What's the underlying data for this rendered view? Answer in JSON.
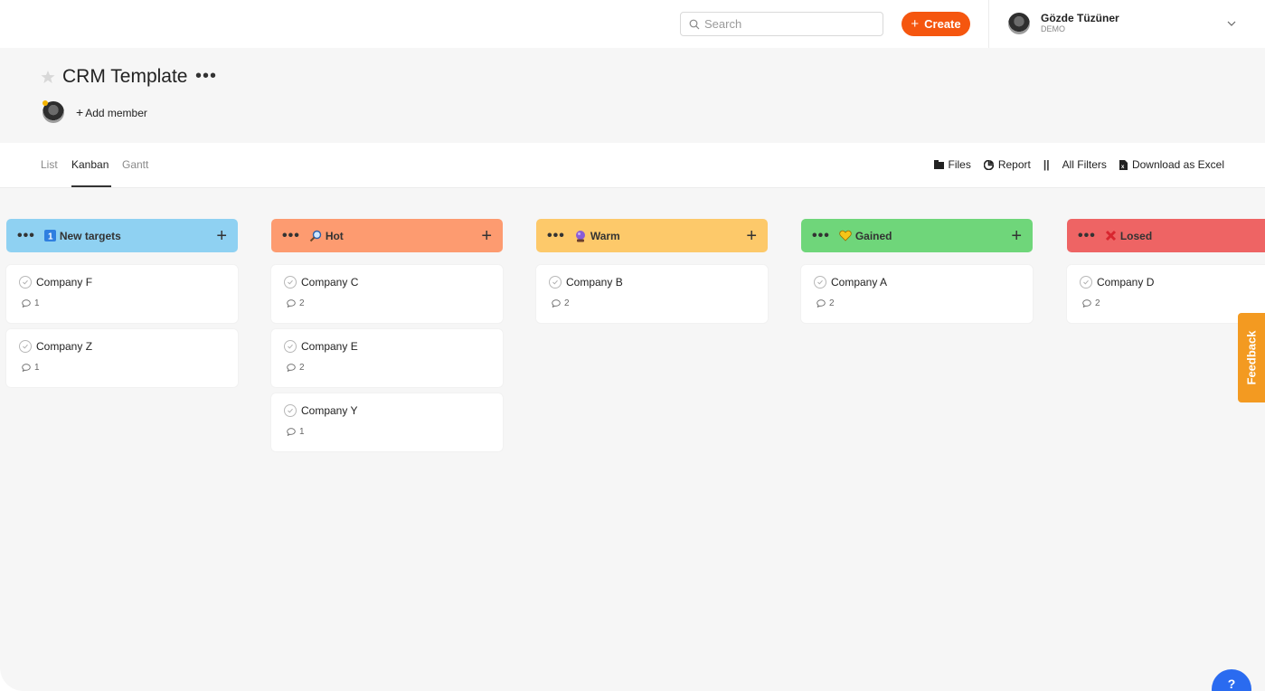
{
  "topbar": {
    "search_placeholder": "Search",
    "create_label": "Create",
    "user_name": "Gözde Tüzüner",
    "user_org": "DEMO"
  },
  "project": {
    "title": "CRM Template",
    "add_member_label": "Add member"
  },
  "tabs": [
    "List",
    "Kanban",
    "Gantt"
  ],
  "active_tab": "Kanban",
  "tools": {
    "files": "Files",
    "report": "Report",
    "filters": "All Filters",
    "download": "Download as Excel"
  },
  "columns": [
    {
      "title": "New targets",
      "icon": "number-one-icon",
      "color": "#8fd1f2",
      "cards": [
        {
          "name": "Company F",
          "comments": "1"
        },
        {
          "name": "Company Z",
          "comments": "1"
        }
      ]
    },
    {
      "title": "Hot",
      "icon": "magnifier-icon",
      "color": "#fd9b70",
      "cards": [
        {
          "name": "Company C",
          "comments": "2"
        },
        {
          "name": "Company E",
          "comments": "2"
        },
        {
          "name": "Company Y",
          "comments": "1"
        }
      ]
    },
    {
      "title": "Warm",
      "icon": "crystal-ball-icon",
      "color": "#fdc96a",
      "cards": [
        {
          "name": "Company B",
          "comments": "2"
        }
      ]
    },
    {
      "title": "Gained",
      "icon": "heart-icon",
      "color": "#6fd67a",
      "cards": [
        {
          "name": "Company A",
          "comments": "2"
        }
      ]
    },
    {
      "title": "Losed",
      "icon": "cross-mark-icon",
      "color": "#ee6464",
      "cards": [
        {
          "name": "Company D",
          "comments": "2"
        }
      ]
    }
  ],
  "feedback_label": "Feedback",
  "help_label": "?",
  "colors": {
    "accent": "#f5560f",
    "feedback": "#f39a21",
    "help": "#2a6bf0"
  }
}
